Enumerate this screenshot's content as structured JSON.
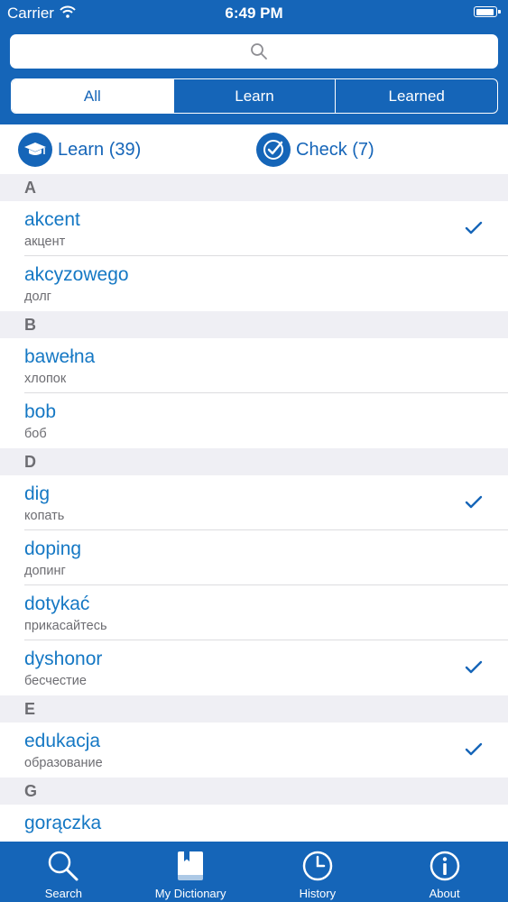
{
  "status_bar": {
    "carrier": "Carrier",
    "time": "6:49 PM"
  },
  "search": {
    "placeholder": ""
  },
  "segments": [
    {
      "label": "All",
      "active": true
    },
    {
      "label": "Learn",
      "active": false
    },
    {
      "label": "Learned",
      "active": false
    }
  ],
  "actions": {
    "learn_label": "Learn (39)",
    "check_label": "Check (7)"
  },
  "sections": [
    {
      "letter": "A",
      "words": [
        {
          "word": "akcent",
          "translation": "акцент",
          "learned": true
        },
        {
          "word": "akcyzowego",
          "translation": "долг",
          "learned": false
        }
      ]
    },
    {
      "letter": "B",
      "words": [
        {
          "word": "bawełna",
          "translation": "хлопок",
          "learned": false
        },
        {
          "word": "bob",
          "translation": "боб",
          "learned": false
        }
      ]
    },
    {
      "letter": "D",
      "words": [
        {
          "word": "dig",
          "translation": "копать",
          "learned": true
        },
        {
          "word": "doping",
          "translation": "допинг",
          "learned": false
        },
        {
          "word": "dotykać",
          "translation": "прикасайтесь",
          "learned": false
        },
        {
          "word": "dyshonor",
          "translation": "бесчестие",
          "learned": true
        }
      ]
    },
    {
      "letter": "E",
      "words": [
        {
          "word": "edukacja",
          "translation": "образование",
          "learned": true
        }
      ]
    },
    {
      "letter": "G",
      "words": [
        {
          "word": "gorączka",
          "translation": "",
          "learned": false
        }
      ]
    }
  ],
  "tabs": [
    {
      "label": "Search",
      "icon": "search-icon"
    },
    {
      "label": "My Dictionary",
      "icon": "book-icon"
    },
    {
      "label": "History",
      "icon": "clock-icon"
    },
    {
      "label": "About",
      "icon": "info-icon"
    }
  ],
  "colors": {
    "brand": "#1565b8",
    "word": "#1578c4",
    "section_bg": "#efeff4"
  }
}
